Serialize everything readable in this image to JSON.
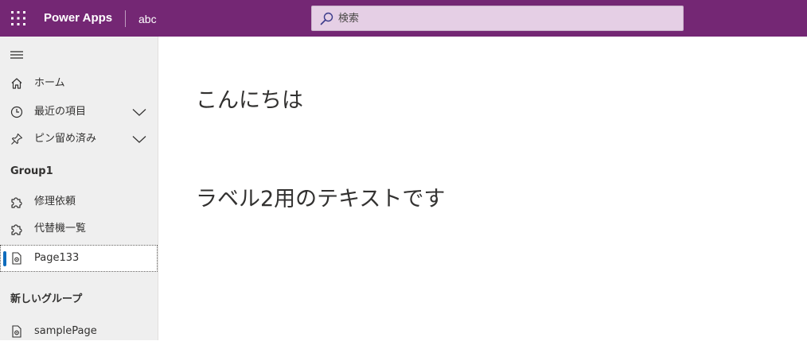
{
  "header": {
    "app_title": "Power Apps",
    "app_name": "abc",
    "search_placeholder": "検索",
    "search_value": "",
    "bar_color": "#742774"
  },
  "sidebar": {
    "top_items": [
      {
        "label": "ホーム",
        "icon": "home-icon",
        "expandable": false
      },
      {
        "label": "最近の項目",
        "icon": "clock-icon",
        "expandable": true
      },
      {
        "label": "ピン留め済み",
        "icon": "pin-icon",
        "expandable": true
      }
    ],
    "groups": [
      {
        "title": "Group1",
        "items": [
          {
            "label": "修理依頼",
            "icon": "puzzle-icon",
            "selected": false
          },
          {
            "label": "代替機一覧",
            "icon": "puzzle-icon",
            "selected": false
          },
          {
            "label": "Page133",
            "icon": "page-gear-icon",
            "selected": true
          }
        ]
      },
      {
        "title": "新しいグループ",
        "items": [
          {
            "label": "samplePage",
            "icon": "page-gear-icon",
            "selected": false
          }
        ]
      }
    ],
    "selected_accent": "#0f6cbd"
  },
  "main": {
    "label1": "こんにちは",
    "label2": "ラベル2用のテキストです"
  }
}
